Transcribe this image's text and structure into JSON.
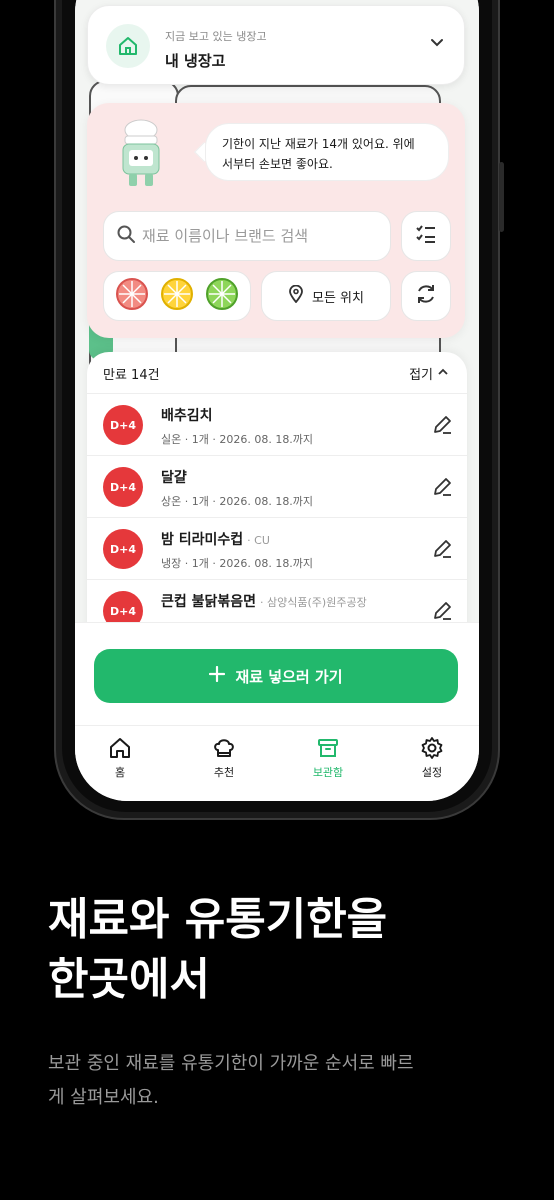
{
  "fridge": {
    "subtitle": "지금 보고 있는 냉장고",
    "title": "내 냉장고"
  },
  "assistant": {
    "message_line1": "기한이 지난 재료가 14개 있어요. 위에",
    "message_line2": "서부터 손보면 좋아요."
  },
  "search": {
    "placeholder": "재료 이름이나 브랜드 검색"
  },
  "filters": {
    "location_label": "모든 위치",
    "fruit_icons": [
      "grapefruit-icon",
      "lemon-icon",
      "lime-icon"
    ]
  },
  "list": {
    "header": "만료 14건",
    "fold_label": "접기",
    "items": [
      {
        "dday": "D+4",
        "name": "배추김치",
        "brand": "",
        "meta": "실온 · 1개 · 2026. 08. 18.까지"
      },
      {
        "dday": "D+4",
        "name": "달걀",
        "brand": "",
        "meta": "상온 · 1개 · 2026. 08. 18.까지"
      },
      {
        "dday": "D+4",
        "name": "밤 티라미수컵",
        "brand": "· CU",
        "meta": "냉장 · 1개 · 2026. 08. 18.까지"
      },
      {
        "dday": "D+4",
        "name": "큰컵 불닭볶음면",
        "brand": "· 삼양식품(주)원주공장",
        "meta": ""
      }
    ]
  },
  "add_button": {
    "label": "재료 넣으러 가기"
  },
  "tabs": [
    {
      "label": "홈",
      "icon": "home-icon",
      "active": false
    },
    {
      "label": "추천",
      "icon": "chef-hat-icon",
      "active": false
    },
    {
      "label": "보관함",
      "icon": "archive-box-icon",
      "active": true
    },
    {
      "label": "설정",
      "icon": "gear-icon",
      "active": false
    }
  ],
  "promo": {
    "headline_line1": "재료와 유통기한을",
    "headline_line2": "한곳에서",
    "subtext_line1": "보관 중인 재료를 유통기한이 가까운 순서로 빠르",
    "subtext_line2": "게 살펴보세요."
  },
  "colors": {
    "accent_green": "#22b86c",
    "danger_red": "#e5383b",
    "panel_pink": "#fbe7e7"
  }
}
